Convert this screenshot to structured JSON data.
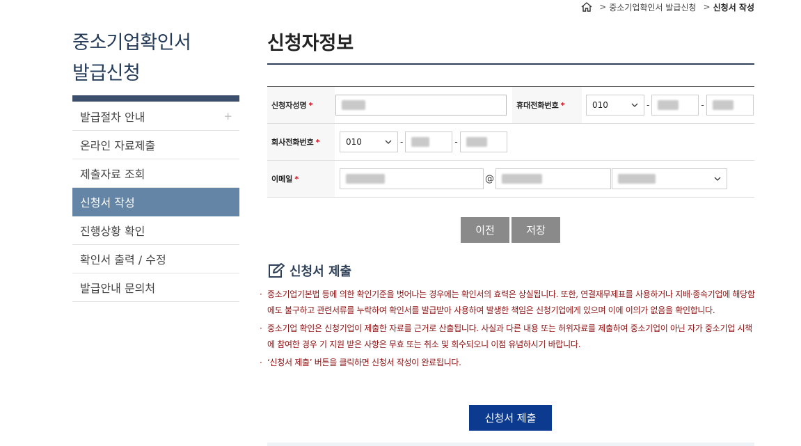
{
  "breadcrumb": {
    "home_icon": "home-icon",
    "items": [
      "중소기업확인서 발급신청",
      "신청서 작성"
    ]
  },
  "sidebar": {
    "title_line1": "중소기업확인서",
    "title_line2": "발급신청",
    "items": [
      {
        "label": "발급절차 안내",
        "expand": "+"
      },
      {
        "label": "온라인 자료제출"
      },
      {
        "label": "제출자료 조회"
      },
      {
        "label": "신청서 작성",
        "active": true
      },
      {
        "label": "진행상황 확인"
      },
      {
        "label": "확인서 출력 / 수정"
      },
      {
        "label": "발급안내 문의처"
      }
    ]
  },
  "main": {
    "title": "신청자정보",
    "form": {
      "applicant_name_label": "신청자성명",
      "mobile_label": "휴대전화번호",
      "mobile_prefix": "010",
      "company_phone_label": "회사전화번호",
      "company_phone_prefix": "010",
      "email_label": "이메일",
      "required_mark": "*",
      "dash": "-",
      "at": "@"
    },
    "buttons": {
      "prev": "이전",
      "save": "저장"
    },
    "submit_section": {
      "title": "신청서 제출",
      "icon": "edit-icon",
      "notes": [
        "중소기업기본법 등에 의한 확인기준을 벗어나는 경우에는 확인서의 효력은 상실됩니다. 또한, 연결재무제표를 사용하거나 지배·종속기업에 해당함에도 불구하고 관련서류를 누락하여 확인서를 발급받아 사용하여 발생한 책임은 신청기업에게 있으며 이에 이의가 없음을 확인합니다.",
        "중소기업 확인은 신청기업이 제출한 자료를 근거로 산출됩니다. 사실과 다른 내용 또는 허위자료를 제출하여 중소기업이 아닌 자가 중소기업 시책에 참여한 경우 기 지원 받은 사항은 무효 또는 취소 및 회수되오니 이점 유념하시기 바랍니다.",
        "‘신청서 제출’ 버튼을 클릭하면 신청서 작성이 완료됩니다."
      ],
      "submit_label": "신청서 제출"
    }
  },
  "colors": {
    "sidebar_title": "#243b5a",
    "sidebar_active": "#6485a5",
    "note_text": "#8e1010",
    "submit_button": "#0b3a8f",
    "grey_button": "#8a8a8a"
  }
}
